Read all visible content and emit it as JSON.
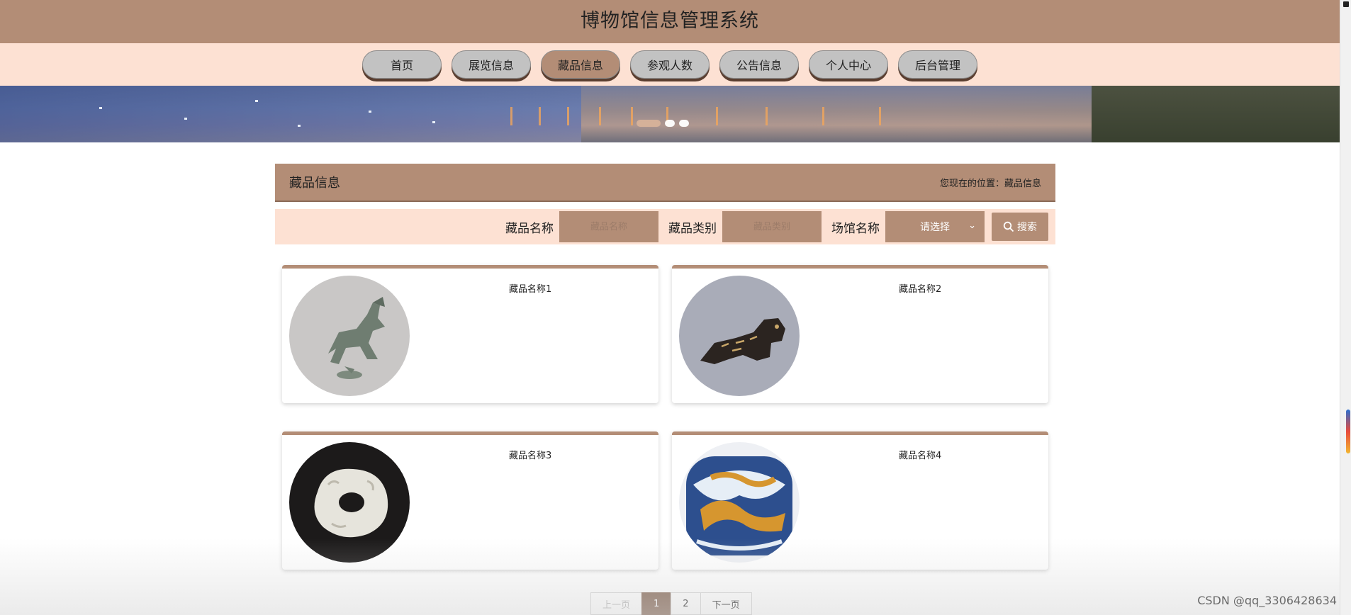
{
  "header": {
    "title": "博物馆信息管理系统"
  },
  "nav": {
    "items": [
      {
        "label": "首页",
        "active": false
      },
      {
        "label": "展览信息",
        "active": false
      },
      {
        "label": "藏品信息",
        "active": true
      },
      {
        "label": "参观人数",
        "active": false
      },
      {
        "label": "公告信息",
        "active": false
      },
      {
        "label": "个人中心",
        "active": false
      },
      {
        "label": "后台管理",
        "active": false
      }
    ]
  },
  "section": {
    "title": "藏品信息",
    "breadcrumb": "您现在的位置：藏品信息"
  },
  "search": {
    "name_label": "藏品名称",
    "name_placeholder": "藏品名称",
    "category_label": "藏品类别",
    "category_placeholder": "藏品类别",
    "venue_label": "场馆名称",
    "venue_selected": "请选择",
    "button_label": "搜索"
  },
  "cards": [
    {
      "name": "藏品名称1",
      "image": "bronze-horse"
    },
    {
      "name": "藏品名称2",
      "image": "bronze-tiger"
    },
    {
      "name": "藏品名称3",
      "image": "jade-pendant"
    },
    {
      "name": "藏品名称4",
      "image": "porcelain-jar"
    }
  ],
  "pagination": {
    "prev_label": "上一页",
    "pages": [
      "1",
      "2"
    ],
    "current": "1",
    "next_label": "下一页"
  },
  "watermark": "CSDN @qq_3306428634",
  "colors": {
    "primary": "#b38d76",
    "nav_background": "#fde1d3",
    "pager_active": "#8a6d5c"
  }
}
